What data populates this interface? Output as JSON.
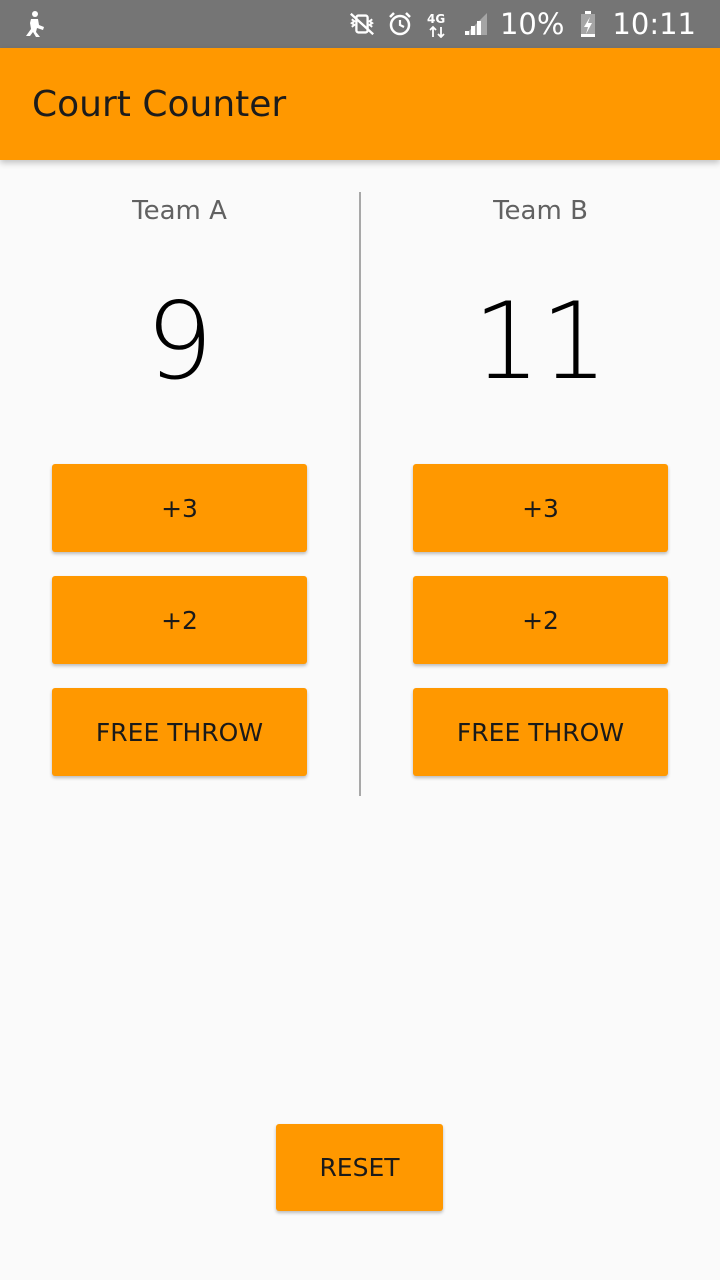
{
  "status_bar": {
    "battery": "10%",
    "time": "10:11",
    "network": "4G",
    "left_icon": "notification-icon",
    "icons": [
      "vibrate-mute-icon",
      "alarm-icon",
      "network-4g-icon",
      "signal-icon",
      "battery-charging-icon"
    ]
  },
  "app_bar": {
    "title": "Court Counter",
    "color": "#ff9800"
  },
  "team_a": {
    "name": "Team A",
    "score": "9",
    "buttons": {
      "plus3": "+3",
      "plus2": "+2",
      "free_throw": "FREE THROW"
    }
  },
  "team_b": {
    "name": "Team B",
    "score": "11",
    "buttons": {
      "plus3": "+3",
      "plus2": "+2",
      "free_throw": "FREE THROW"
    }
  },
  "reset_label": "RESET"
}
